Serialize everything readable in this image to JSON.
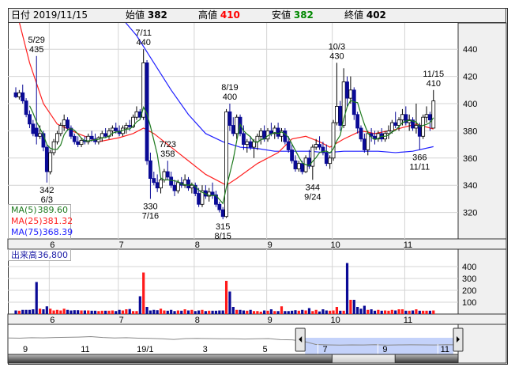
{
  "header": {
    "date_label": "日付",
    "date": "2019/11/15",
    "open_label": "始値",
    "open": "382",
    "high_label": "高値",
    "high": "410",
    "low_label": "安値",
    "low": "382",
    "close_label": "終値",
    "close": "402"
  },
  "colors": {
    "up_fill": "#ffffff",
    "down_fill": "#0a0a96",
    "vol_up": "#ff1a1a",
    "vol_down": "#0a0a96",
    "vol_flat": "#999999",
    "ma5": "#1e7a1e",
    "ma25": "#ff2020",
    "ma75": "#2020ff",
    "nav_sel": "#c4d2fa"
  },
  "legend": {
    "ma5_label": "MA(5)",
    "ma5_value": "389.60",
    "ma25_label": "MA(25)",
    "ma25_value": "381.32",
    "ma75_label": "MA(75)",
    "ma75_value": "368.39"
  },
  "volume_legend": {
    "label": "出来高",
    "value": "36,800"
  },
  "chart_data": {
    "type": "candlestick",
    "price_ticks": [
      "320",
      "340",
      "360",
      "380",
      "400",
      "420",
      "440"
    ],
    "volume_ticks": [
      "100",
      "200",
      "300",
      "400"
    ],
    "months": [
      {
        "label": "6",
        "start": 9
      },
      {
        "label": "7",
        "start": 29
      },
      {
        "label": "8",
        "start": 51
      },
      {
        "label": "9",
        "start": 72
      },
      {
        "label": "10",
        "start": 91
      },
      {
        "label": "11",
        "start": 112
      }
    ],
    "candles": [
      [
        408,
        412,
        404,
        405
      ],
      [
        405,
        410,
        403,
        408
      ],
      [
        408,
        414,
        400,
        402
      ],
      [
        402,
        404,
        390,
        392
      ],
      [
        392,
        395,
        382,
        385
      ],
      [
        385,
        388,
        376,
        378
      ],
      [
        382,
        435,
        370,
        376
      ],
      [
        376,
        384,
        374,
        378
      ],
      [
        378,
        380,
        365,
        368
      ],
      [
        368,
        370,
        342,
        350
      ],
      [
        350,
        366,
        348,
        364
      ],
      [
        364,
        374,
        362,
        372
      ],
      [
        372,
        380,
        370,
        378
      ],
      [
        378,
        386,
        376,
        384
      ],
      [
        384,
        392,
        380,
        388
      ],
      [
        388,
        390,
        380,
        382
      ],
      [
        382,
        384,
        374,
        376
      ],
      [
        376,
        378,
        370,
        372
      ],
      [
        372,
        376,
        368,
        370
      ],
      [
        370,
        375,
        368,
        373
      ],
      [
        373,
        376,
        370,
        372
      ],
      [
        372,
        378,
        370,
        376
      ],
      [
        376,
        380,
        372,
        374
      ],
      [
        374,
        378,
        370,
        372
      ],
      [
        372,
        376,
        370,
        375
      ],
      [
        375,
        380,
        372,
        378
      ],
      [
        378,
        382,
        375,
        376
      ],
      [
        376,
        382,
        374,
        380
      ],
      [
        380,
        384,
        376,
        382
      ],
      [
        382,
        386,
        378,
        380
      ],
      [
        380,
        384,
        376,
        378
      ],
      [
        378,
        384,
        376,
        382
      ],
      [
        382,
        386,
        378,
        384
      ],
      [
        384,
        388,
        380,
        383
      ],
      [
        383,
        392,
        382,
        390
      ],
      [
        390,
        398,
        388,
        394
      ],
      [
        394,
        396,
        388,
        390
      ],
      [
        390,
        440,
        388,
        430
      ],
      [
        430,
        432,
        355,
        358
      ],
      [
        358,
        364,
        330,
        345
      ],
      [
        345,
        350,
        340,
        342
      ],
      [
        342,
        348,
        335,
        338
      ],
      [
        338,
        346,
        334,
        344
      ],
      [
        344,
        352,
        342,
        350
      ],
      [
        350,
        358,
        344,
        346
      ],
      [
        346,
        350,
        338,
        340
      ],
      [
        340,
        344,
        332,
        336
      ],
      [
        336,
        344,
        334,
        342
      ],
      [
        342,
        346,
        338,
        340
      ],
      [
        340,
        348,
        338,
        344
      ],
      [
        344,
        346,
        336,
        338
      ],
      [
        338,
        342,
        334,
        340
      ],
      [
        340,
        342,
        332,
        334
      ],
      [
        334,
        338,
        324,
        326
      ],
      [
        326,
        340,
        324,
        336
      ],
      [
        336,
        340,
        330,
        332
      ],
      [
        332,
        338,
        328,
        335
      ],
      [
        335,
        342,
        330,
        333
      ],
      [
        333,
        336,
        324,
        326
      ],
      [
        326,
        328,
        320,
        322
      ],
      [
        322,
        324,
        315,
        317
      ],
      [
        317,
        396,
        316,
        394
      ],
      [
        394,
        400,
        380,
        384
      ],
      [
        384,
        390,
        376,
        378
      ],
      [
        378,
        392,
        374,
        390
      ],
      [
        390,
        392,
        376,
        378
      ],
      [
        378,
        384,
        366,
        370
      ],
      [
        370,
        374,
        364,
        372
      ],
      [
        372,
        376,
        366,
        368
      ],
      [
        368,
        374,
        360,
        372
      ],
      [
        372,
        378,
        366,
        376
      ],
      [
        376,
        382,
        370,
        380
      ],
      [
        380,
        384,
        372,
        374
      ],
      [
        374,
        382,
        372,
        380
      ],
      [
        380,
        386,
        376,
        378
      ],
      [
        378,
        384,
        374,
        382
      ],
      [
        382,
        386,
        374,
        376
      ],
      [
        376,
        382,
        372,
        380
      ],
      [
        380,
        382,
        370,
        372
      ],
      [
        372,
        376,
        364,
        366
      ],
      [
        366,
        370,
        356,
        358
      ],
      [
        358,
        362,
        350,
        352
      ],
      [
        352,
        358,
        350,
        356
      ],
      [
        356,
        358,
        348,
        350
      ],
      [
        350,
        362,
        349,
        360
      ],
      [
        360,
        366,
        352,
        354
      ],
      [
        354,
        370,
        344,
        368
      ],
      [
        368,
        374,
        366,
        370
      ],
      [
        370,
        376,
        366,
        368
      ],
      [
        368,
        372,
        362,
        364
      ],
      [
        364,
        370,
        354,
        356
      ],
      [
        356,
        362,
        352,
        360
      ],
      [
        360,
        388,
        358,
        386
      ],
      [
        386,
        430,
        384,
        398
      ],
      [
        398,
        402,
        380,
        384
      ],
      [
        384,
        426,
        382,
        416
      ],
      [
        416,
        420,
        398,
        404
      ],
      [
        404,
        420,
        400,
        410
      ],
      [
        410,
        412,
        388,
        392
      ],
      [
        392,
        394,
        378,
        382
      ],
      [
        382,
        384,
        372,
        374
      ],
      [
        374,
        378,
        364,
        366
      ],
      [
        366,
        380,
        362,
        378
      ],
      [
        378,
        382,
        372,
        376
      ],
      [
        376,
        380,
        370,
        374
      ],
      [
        374,
        380,
        372,
        378
      ],
      [
        378,
        382,
        372,
        374
      ],
      [
        374,
        380,
        372,
        378
      ],
      [
        378,
        384,
        374,
        380
      ],
      [
        380,
        388,
        378,
        386
      ],
      [
        386,
        394,
        382,
        384
      ],
      [
        384,
        390,
        380,
        388
      ],
      [
        388,
        396,
        384,
        392
      ],
      [
        392,
        398,
        384,
        386
      ],
      [
        386,
        392,
        380,
        388
      ],
      [
        388,
        390,
        380,
        382
      ],
      [
        382,
        400,
        378,
        384
      ],
      [
        384,
        386,
        366,
        376
      ],
      [
        376,
        392,
        374,
        390
      ],
      [
        390,
        398,
        386,
        392
      ],
      [
        392,
        394,
        380,
        388
      ],
      [
        382,
        410,
        382,
        402
      ]
    ],
    "volume": [
      30,
      28,
      35,
      35,
      35,
      40,
      270,
      45,
      40,
      65,
      45,
      30,
      35,
      30,
      45,
      35,
      30,
      32,
      32,
      30,
      30,
      30,
      28,
      28,
      25,
      28,
      28,
      28,
      30,
      25,
      35,
      30,
      40,
      42,
      25,
      25,
      150,
      350,
      60,
      30,
      35,
      32,
      45,
      30,
      28,
      35,
      25,
      30,
      28,
      40,
      30,
      35,
      25,
      30,
      35,
      25,
      28,
      28,
      28,
      30,
      30,
      280,
      190,
      60,
      35,
      35,
      30,
      28,
      35,
      25,
      25,
      20,
      30,
      28,
      40,
      25,
      25,
      65,
      25,
      25,
      28,
      32,
      28,
      35,
      30,
      50,
      25,
      35,
      22,
      40,
      30,
      28,
      30,
      60,
      28,
      28,
      430,
      120,
      120,
      60,
      45,
      70,
      35,
      40,
      28,
      35,
      28,
      30,
      28,
      35,
      30,
      40,
      40,
      28,
      28,
      30,
      40,
      28,
      28,
      28,
      28,
      30,
      36.8
    ],
    "ma25": [
      [
        0,
        470
      ],
      [
        4,
        430
      ],
      [
        8,
        400
      ],
      [
        12,
        385
      ],
      [
        18,
        378
      ],
      [
        24,
        372
      ],
      [
        30,
        375
      ],
      [
        34,
        378
      ],
      [
        37,
        382
      ],
      [
        40,
        378
      ],
      [
        45,
        368
      ],
      [
        50,
        358
      ],
      [
        55,
        348
      ],
      [
        61,
        340
      ],
      [
        64,
        345
      ],
      [
        70,
        356
      ],
      [
        76,
        364
      ],
      [
        80,
        374
      ],
      [
        84,
        376
      ],
      [
        88,
        372
      ],
      [
        91,
        368
      ],
      [
        95,
        374
      ],
      [
        100,
        380
      ],
      [
        104,
        378
      ],
      [
        110,
        381
      ],
      [
        116,
        385
      ],
      [
        121,
        381.32
      ]
    ],
    "ma75": [
      [
        31,
        462
      ],
      [
        35,
        450
      ],
      [
        40,
        430
      ],
      [
        45,
        410
      ],
      [
        50,
        392
      ],
      [
        55,
        378
      ],
      [
        60,
        372
      ],
      [
        65,
        368
      ],
      [
        70,
        367
      ],
      [
        75,
        365
      ],
      [
        80,
        365
      ],
      [
        85,
        365
      ],
      [
        90,
        364
      ],
      [
        95,
        365
      ],
      [
        100,
        365
      ],
      [
        105,
        365
      ],
      [
        110,
        364
      ],
      [
        115,
        365
      ],
      [
        121,
        368.39
      ]
    ],
    "annotations": [
      {
        "i": 6,
        "date": "5/29",
        "price": "435",
        "pos": "above"
      },
      {
        "i": 9,
        "date": "6/3",
        "price": "342",
        "pos": "below"
      },
      {
        "i": 37,
        "date": "7/11",
        "price": "440",
        "pos": "above"
      },
      {
        "i": 39,
        "date": "7/16",
        "price": "330",
        "pos": "below"
      },
      {
        "i": 44,
        "date": "7/23",
        "price": "358",
        "pos": "above"
      },
      {
        "i": 60,
        "date": "8/15",
        "price": "315",
        "pos": "below"
      },
      {
        "i": 62,
        "date": "8/19",
        "price": "400",
        "pos": "above"
      },
      {
        "i": 86,
        "date": "9/24",
        "price": "344",
        "pos": "below"
      },
      {
        "i": 93,
        "date": "10/3",
        "price": "430",
        "pos": "above"
      },
      {
        "i": 117,
        "date": "11/11",
        "price": "366",
        "pos": "below"
      },
      {
        "i": 121,
        "date": "11/15",
        "price": "410",
        "pos": "above"
      }
    ]
  },
  "navigator": {
    "labels": [
      "9",
      "11",
      "19/1",
      "3",
      "5",
      "7",
      "9",
      "11"
    ],
    "series": [
      560,
      555,
      565,
      562,
      570,
      575,
      580,
      590,
      570,
      560,
      565,
      555,
      550,
      540,
      525,
      545,
      550,
      545,
      540,
      540,
      535,
      540,
      545,
      520,
      515,
      480,
      410,
      400,
      395,
      400,
      398,
      405,
      395,
      400,
      402,
      400,
      398,
      404,
      400
    ],
    "selection_start": 0.66,
    "selection_end": 1.0,
    "scroll_thumb_start": 0.72,
    "scroll_thumb_end": 0.86
  }
}
